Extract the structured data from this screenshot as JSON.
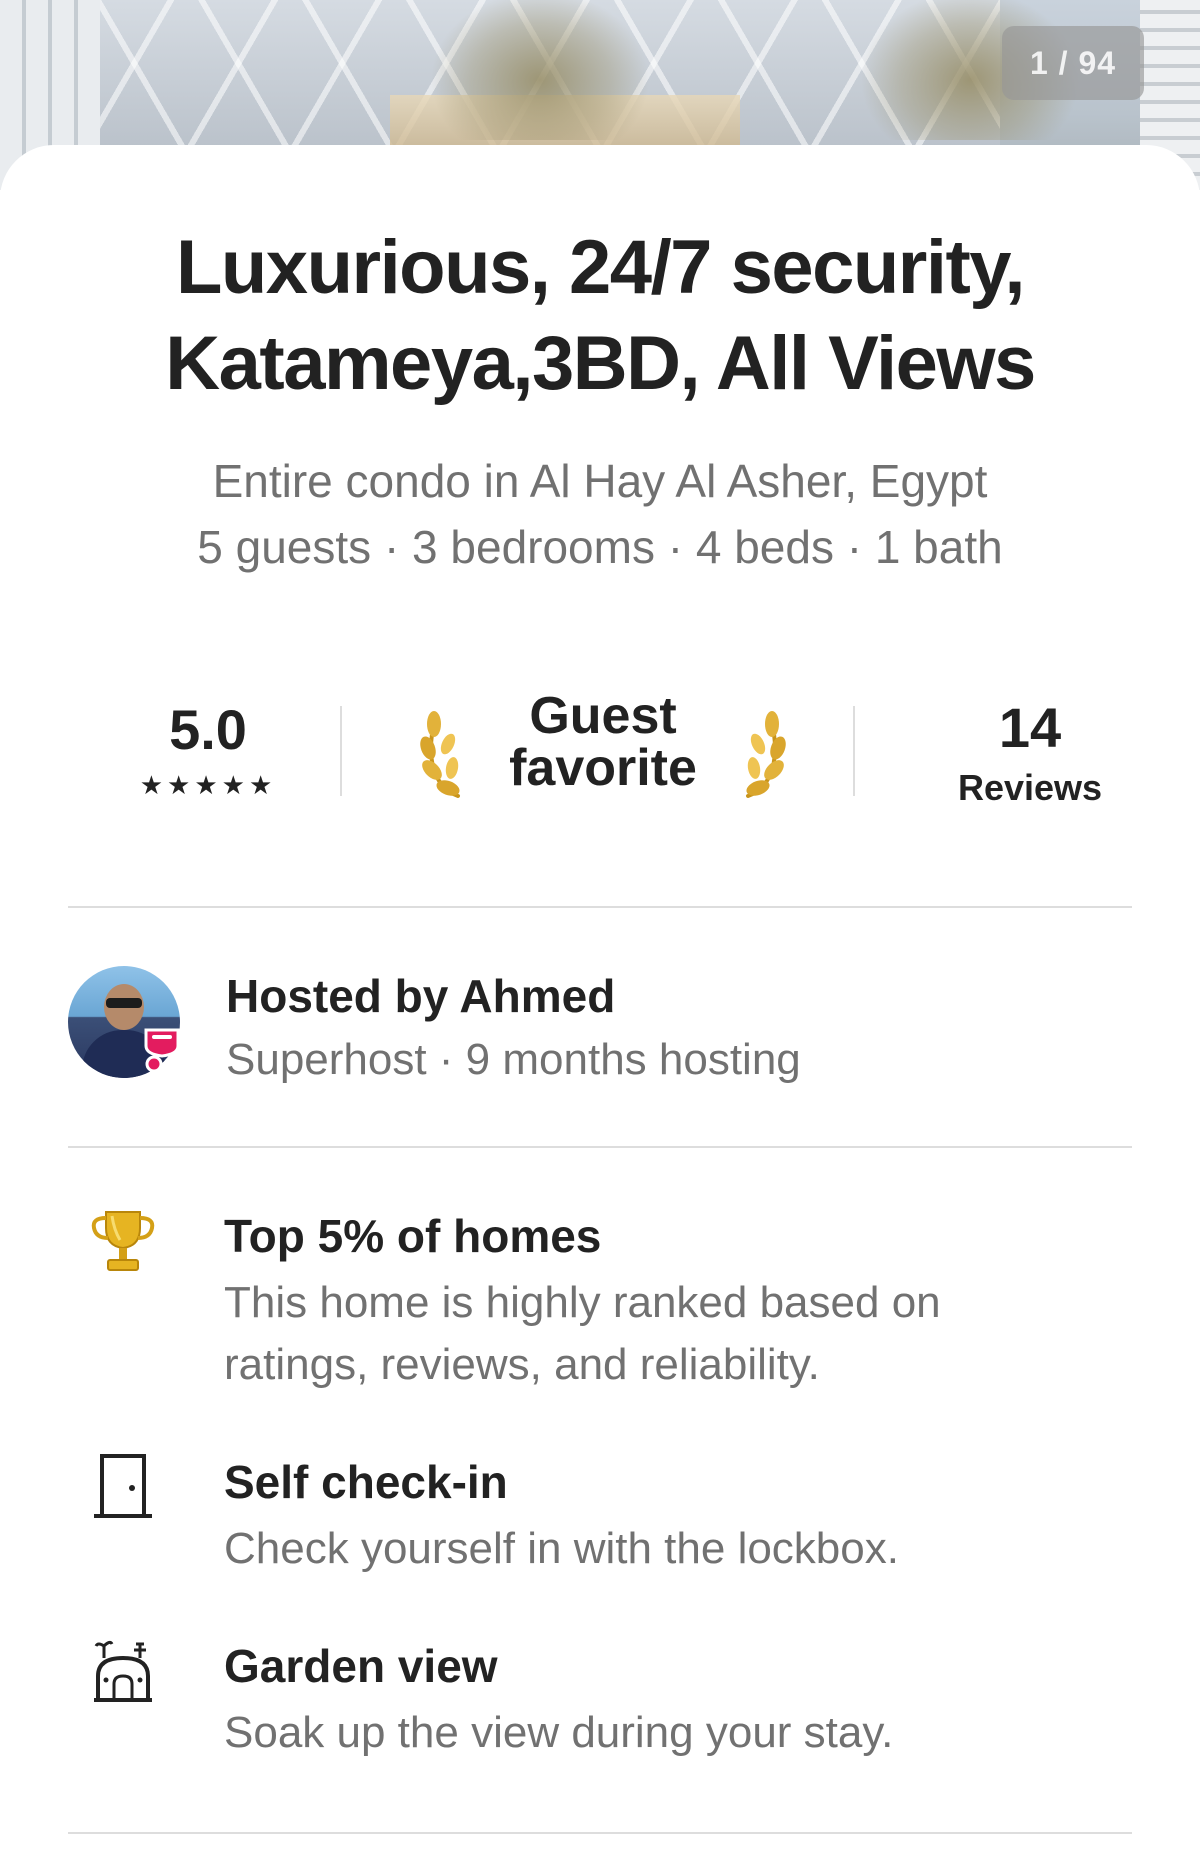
{
  "gallery": {
    "counter": "1 / 94"
  },
  "listing": {
    "title_line1": "Luxurious, 24/7 security,",
    "title_line2": "Katameya,3BD, All Views",
    "location": "Entire condo in Al Hay Al Asher, Egypt",
    "details": "5 guests · 3 bedrooms · 4 beds · 1 bath"
  },
  "stats": {
    "rating": "5.0",
    "stars": "★★★★★",
    "rating_value": 5,
    "favorite_line1": "Guest",
    "favorite_line2": "favorite",
    "reviews_count": "14",
    "reviews_label": "Reviews"
  },
  "host": {
    "name": "Hosted by Ahmed",
    "meta": "Superhost · 9 months hosting"
  },
  "highlights": [
    {
      "icon": "trophy-icon",
      "title": "Top 5% of homes",
      "desc_line1": "This home is highly ranked based on",
      "desc_line2": "ratings, reviews, and reliability."
    },
    {
      "icon": "door-icon",
      "title": "Self check-in",
      "desc_line1": "Check yourself in with the lockbox."
    },
    {
      "icon": "garden-icon",
      "title": "Garden view",
      "desc_line1": "Soak up the view during your stay."
    }
  ],
  "colors": {
    "text_primary": "#222222",
    "text_secondary": "#717171",
    "divider": "#dddddd",
    "superhost_badge": "#e31c5f",
    "laurel_gold": "#d4a017"
  }
}
